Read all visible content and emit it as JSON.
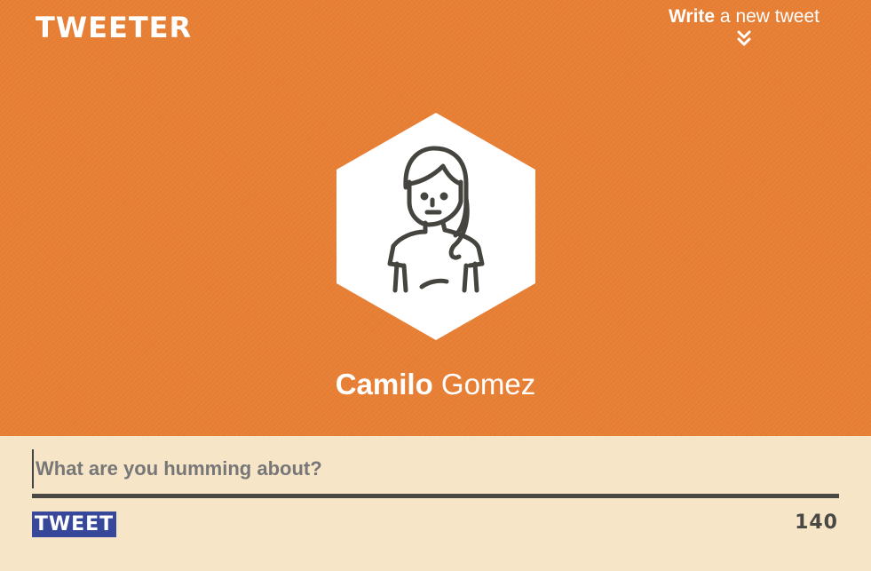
{
  "header": {
    "logo": "TWEETER",
    "write_link": {
      "bold": "Write",
      "rest": " a new tweet",
      "icon": "double-chevron-down-icon"
    }
  },
  "profile": {
    "avatar_icon": "woman-avatar-icon",
    "first_name": "Camilo",
    "last_name": "Gomez"
  },
  "composer": {
    "placeholder": "What are you humming about?",
    "value": "",
    "button_label": "TWEET",
    "char_count": "140"
  },
  "colors": {
    "header_bg": "#e87f34",
    "composer_bg": "#f7e5c8",
    "button_bg": "#37479a",
    "dark": "#4a4845"
  }
}
